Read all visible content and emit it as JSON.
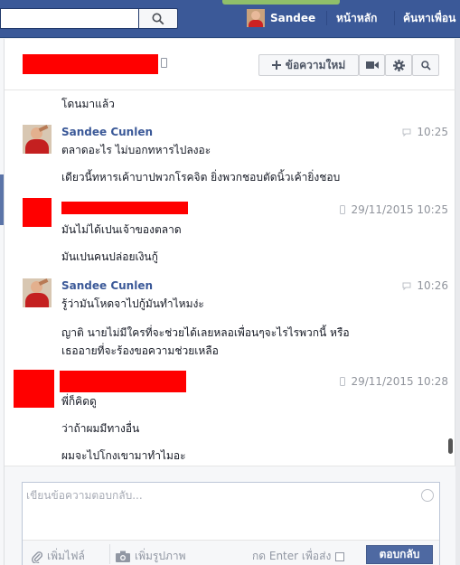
{
  "topbar": {
    "user_name": "Sandee",
    "home_label": "หน้าหลัก",
    "find_friends_label": "ค้นหาเพื่อน"
  },
  "header": {
    "new_message_label": "ข้อความใหม่"
  },
  "messages": [
    {
      "text": "โดนมาแล้ว"
    },
    {
      "sender": "Sandee Cunlen",
      "time": "10:25",
      "lines": [
        "ตลาดอะไร ไม่บอกทหารไปลงอะ",
        "เดียวนี้ทหารเค้าบาปพวกโรคจิต ยิ่งพวกชอบตัดนิ้วเค้ายิ่งชอบ"
      ]
    },
    {
      "time": "29/11/2015 10:25",
      "lines": [
        "มันไม่ได้เปนเจ้าของตลาด",
        "มันเปนคนปล่อยเงินกู้"
      ]
    },
    {
      "sender": "Sandee Cunlen",
      "time": "10:26",
      "lines": [
        "รู้ว่ามันโหดจาไปกู้มันทำไหมง่ะ",
        "ญาติ นายไม่มีใครที่จะช่วยได้เลยหลอเพื่อนๆจะไรไรพวกนี้ หรือ",
        "เธออายที่จะร้องขอความช่วยเหลือ"
      ]
    },
    {
      "time": "29/11/2015 10:28",
      "lines": [
        "พี่ก็คิดดู",
        "ว่าถ้าผมมีทางอื่น",
        "ผมจะไปโกงเขามาทำไมอะ"
      ]
    }
  ],
  "composer": {
    "placeholder": "เขียนข้อความตอบกลับ...",
    "add_file_label": "เพิ่มไฟล์",
    "add_photo_label": "เพิ่มรูปภาพ",
    "enter_to_send_label": "กด Enter เพื่อส่ง",
    "reply_label": "ตอบกลับ"
  },
  "colors": {
    "brand": "#3b5998",
    "redaction": "#ff0000",
    "reply_button": "#4e69a2"
  }
}
